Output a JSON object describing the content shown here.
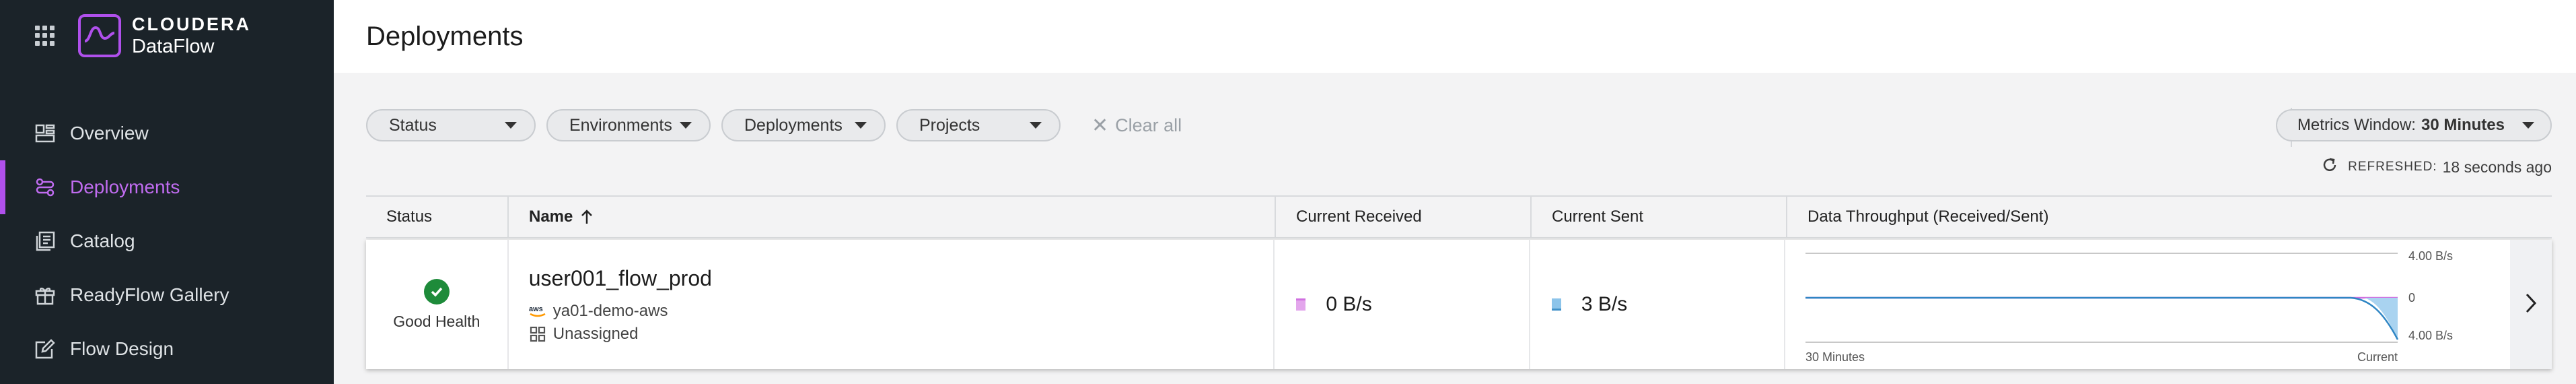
{
  "brand": {
    "company": "CLOUDERA",
    "product": "DataFlow"
  },
  "nav": [
    {
      "label": "Overview",
      "icon": "overview-icon",
      "active": false
    },
    {
      "label": "Deployments",
      "icon": "deployments-icon",
      "active": true
    },
    {
      "label": "Catalog",
      "icon": "catalog-icon",
      "active": false
    },
    {
      "label": "ReadyFlow Gallery",
      "icon": "gift-icon",
      "active": false
    },
    {
      "label": "Flow Design",
      "icon": "edit-icon",
      "active": false
    }
  ],
  "page_title": "Deployments",
  "filters": {
    "status": "Status",
    "environments": "Environments",
    "deployments": "Deployments",
    "projects": "Projects",
    "clear_all": "Clear all"
  },
  "metrics_window": {
    "label": "Metrics Window:",
    "value": "30 Minutes"
  },
  "refreshed": {
    "label": "REFRESHED:",
    "value": "18 seconds ago"
  },
  "table": {
    "columns": [
      "Status",
      "Name",
      "Current Received",
      "Current Sent",
      "Data Throughput (Received/Sent)"
    ],
    "rows": [
      {
        "status": "Good Health",
        "name": "user001_flow_prod",
        "environment": "ya01-demo-aws",
        "project": "Unassigned",
        "received": "0 B/s",
        "sent": "3 B/s",
        "chart": {
          "top_label": "4.00 B/s",
          "mid_label": "0",
          "bottom_label": "4.00 B/s",
          "x_start": "30 Minutes",
          "x_end": "Current"
        }
      }
    ]
  },
  "colors": {
    "accent": "#b050ec",
    "received": "#d070e0",
    "sent": "#5aa8dc",
    "healthy": "#1e8b3a"
  }
}
